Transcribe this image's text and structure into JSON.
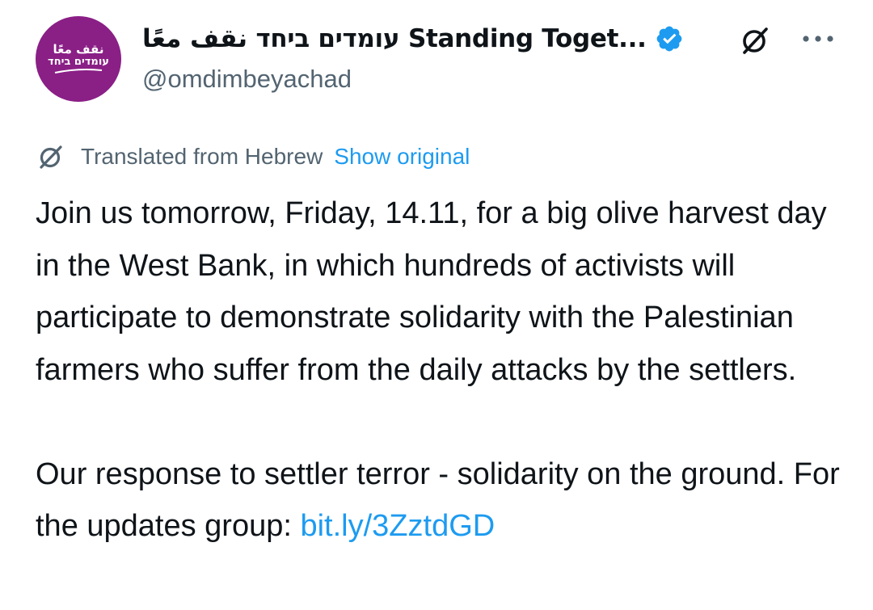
{
  "header": {
    "display_name": "עומדים ביחד نقف معًا Standing Toget...",
    "handle": "@omdimbeyachad"
  },
  "avatar": {
    "line1": "نقف معًا",
    "line2": "עומדים ביחד",
    "color": "#8a1f86"
  },
  "icons": {
    "verified": "verified-badge-icon",
    "grok": "grok-icon",
    "more": "more-icon",
    "translate": "translate-icon"
  },
  "translation": {
    "label": "Translated from Hebrew",
    "action": "Show original"
  },
  "tweet": {
    "paragraph1": "Join us tomorrow, Friday, 14.11, for a big olive harvest day in the West Bank, in which hundreds of activists will participate to demonstrate solidarity with the Palestinian farmers who suffer from the daily attacks by the settlers.",
    "paragraph2_text": "Our response to settler terror - solidarity on the ground. For the updates group: ",
    "link": "bit.ly/3ZztdGD"
  },
  "colors": {
    "text": "#0f1419",
    "secondary": "#536471",
    "accent": "#1d9bf0"
  }
}
